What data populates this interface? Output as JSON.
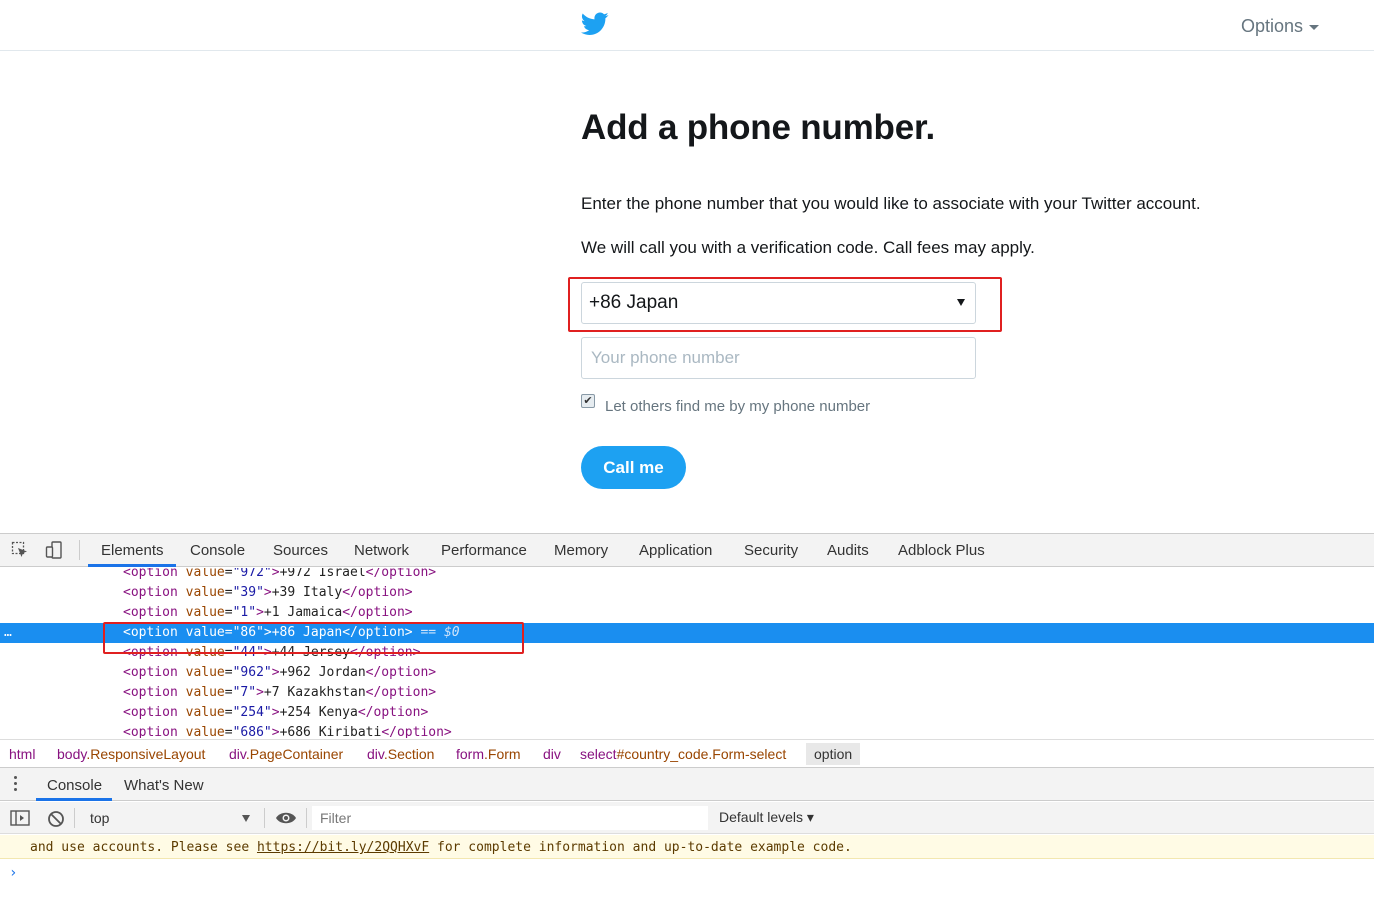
{
  "header": {
    "logo": "twitter-bird-icon",
    "options_label": "Options"
  },
  "main": {
    "title": "Add a phone number.",
    "description_1": "Enter the phone number that you would like to associate with your Twitter account.",
    "description_2": "We will call you with a verification code. Call fees may apply.",
    "country_select_value": "+86 Japan",
    "phone_placeholder": "Your phone number",
    "discoverable_checked": true,
    "discoverable_label": "Let others find me by my phone number",
    "submit_label": "Call me",
    "accent_color": "#1da1f2"
  },
  "devtools": {
    "tabs": [
      "Elements",
      "Console",
      "Sources",
      "Network",
      "Performance",
      "Memory",
      "Application",
      "Security",
      "Audits",
      "Adblock Plus"
    ],
    "active_tab": "Elements",
    "dom_lines": [
      {
        "value": "972",
        "text": "+972 Israel"
      },
      {
        "value": "39",
        "text": "+39 Italy"
      },
      {
        "value": "1",
        "text": "+1 Jamaica"
      },
      {
        "value": "86",
        "text": "+86 Japan",
        "selected": true,
        "suffix": "== $0"
      },
      {
        "value": "44",
        "text": "+44 Jersey"
      },
      {
        "value": "962",
        "text": "+962 Jordan"
      },
      {
        "value": "7",
        "text": "+7 Kazakhstan"
      },
      {
        "value": "254",
        "text": "+254 Kenya"
      },
      {
        "value": "686",
        "text": "+686 Kiribati"
      }
    ],
    "breadcrumbs": [
      {
        "tag": "html",
        "cls": ""
      },
      {
        "tag": "body",
        "cls": ".ResponsiveLayout"
      },
      {
        "tag": "div",
        "cls": ".PageContainer"
      },
      {
        "tag": "div",
        "cls": ".Section"
      },
      {
        "tag": "form",
        "cls": ".Form"
      },
      {
        "tag": "div",
        "cls": ""
      },
      {
        "tag": "select",
        "cls": "#country_code.Form-select"
      },
      {
        "tag": "option",
        "cls": ""
      }
    ],
    "drawer_tabs": [
      "Console",
      "What's New"
    ],
    "context": "top",
    "filter_placeholder": "Filter",
    "levels_label": "Default levels ▾",
    "warning_prefix": "and use accounts. Please see ",
    "warning_link": "https://bit.ly/2QQHXvF",
    "warning_suffix": " for complete information and up-to-date example code.",
    "prompt": "›"
  }
}
